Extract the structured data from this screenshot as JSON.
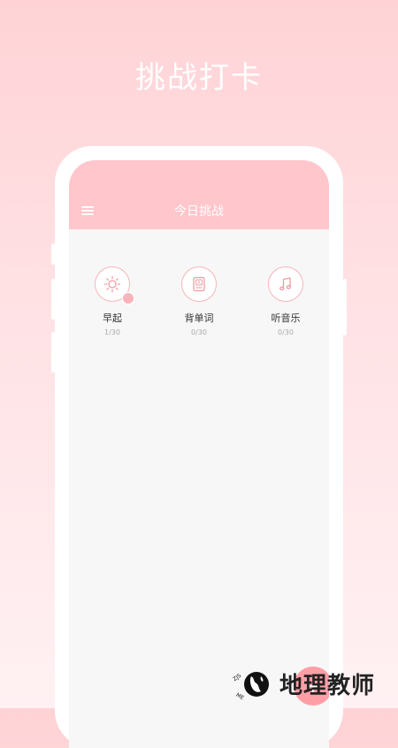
{
  "promo": {
    "title": "挑战打卡"
  },
  "appbar": {
    "title": "今日挑战",
    "menu_icon": "menu-icon"
  },
  "challenges": [
    {
      "name": "早起",
      "count": "1/30",
      "icon": "sun-icon",
      "checked": true
    },
    {
      "name": "背单词",
      "count": "0/30",
      "icon": "word-card-icon",
      "checked": false
    },
    {
      "name": "听音乐",
      "count": "0/30",
      "icon": "music-note-icon",
      "checked": false
    }
  ],
  "fab": {
    "label": "+"
  },
  "watermark": {
    "text": "地理教师",
    "logo_text": "ZJS-ME"
  },
  "colors": {
    "accent": "#ffc6cb",
    "ring": "#f7b5bb",
    "fab": "#ff9ea5"
  }
}
